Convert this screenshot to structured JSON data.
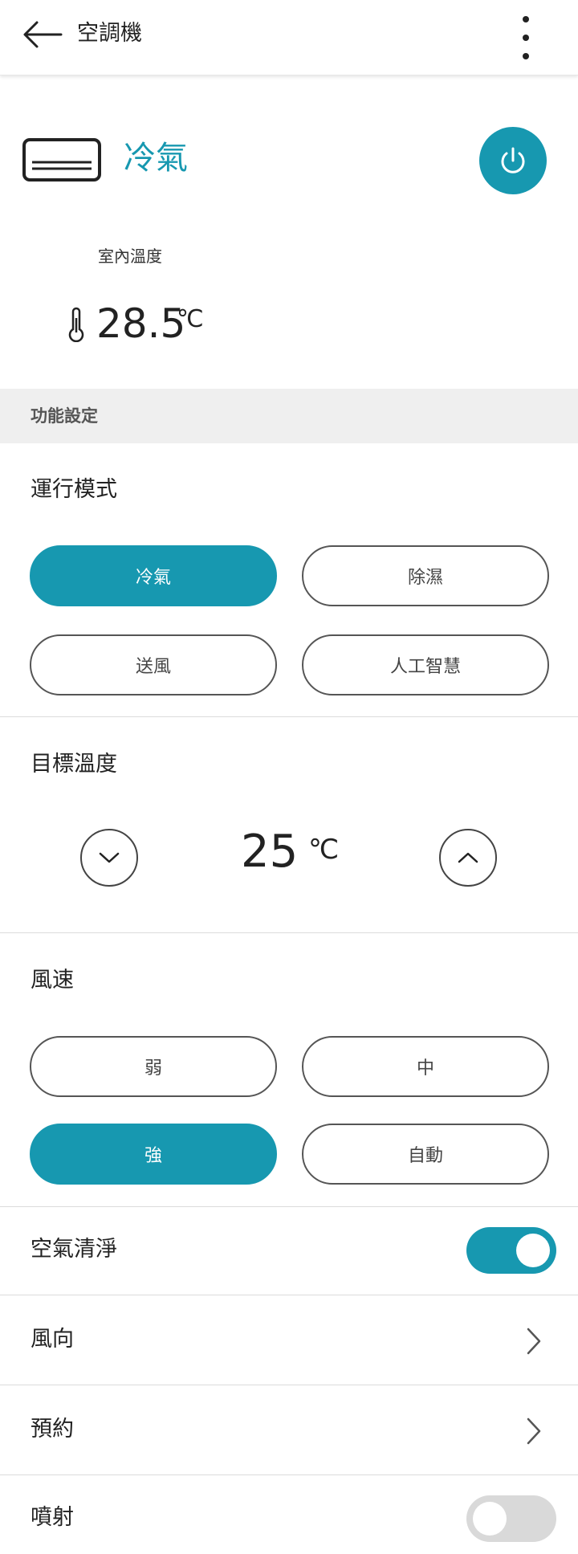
{
  "header": {
    "title": "空調機",
    "back_icon": "arrow-left-icon",
    "more_icon": "more-vertical-icon"
  },
  "status": {
    "device_icon": "air-conditioner-icon",
    "mode": "冷氣",
    "power_icon": "power-icon",
    "indoor_label": "室內溫度",
    "indoor_temp": "28.5",
    "indoor_unit": "℃",
    "accent_color": "#1798b0"
  },
  "section_header": "功能設定",
  "operation_mode": {
    "title": "運行模式",
    "options": [
      {
        "label": "冷氣",
        "selected": true
      },
      {
        "label": "除濕",
        "selected": false
      },
      {
        "label": "送風",
        "selected": false
      },
      {
        "label": "人工智慧",
        "selected": false
      }
    ]
  },
  "target_temp": {
    "title": "目標溫度",
    "value": "25",
    "unit": "℃"
  },
  "fan_speed": {
    "title": "風速",
    "options": [
      {
        "label": "弱",
        "selected": false
      },
      {
        "label": "中",
        "selected": false
      },
      {
        "label": "強",
        "selected": true
      },
      {
        "label": "自動",
        "selected": false
      }
    ]
  },
  "settings": {
    "air_purify": {
      "label": "空氣清淨",
      "on": true
    },
    "wind_direction": {
      "label": "風向"
    },
    "schedule": {
      "label": "預約"
    },
    "jet": {
      "label": "噴射",
      "on": false
    }
  }
}
